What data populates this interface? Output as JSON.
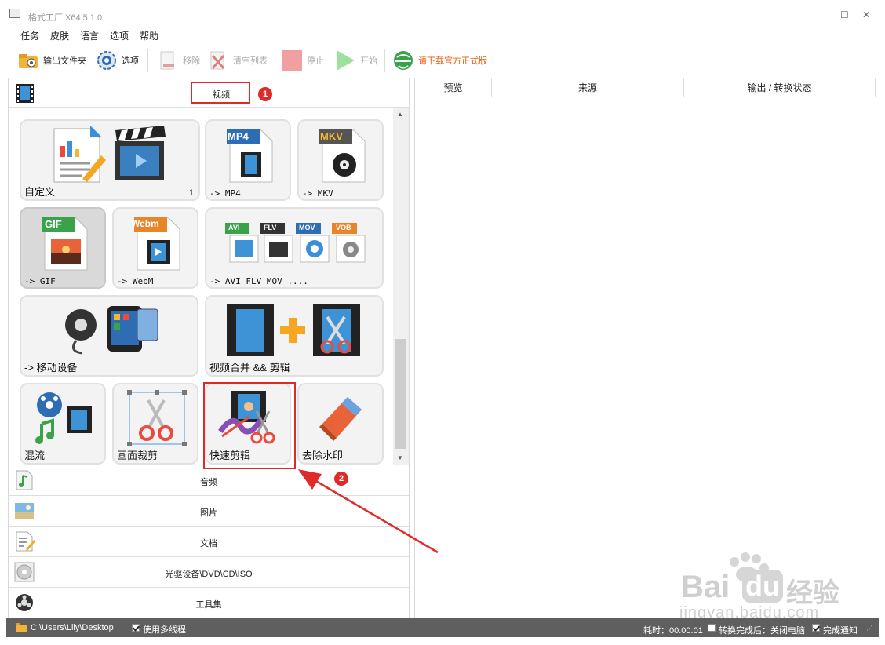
{
  "window": {
    "title": "格式工厂 X64 5.1.0",
    "minimize": "–",
    "maximize": "☐",
    "close": "✕"
  },
  "menu": [
    "任务",
    "皮肤",
    "语言",
    "选项",
    "帮助"
  ],
  "toolbar": {
    "output_folder": "输出文件夹",
    "options": "选项",
    "remove": "移除",
    "clear_list": "清空列表",
    "stop": "停止",
    "start": "开始",
    "download": "请下载官方正式版"
  },
  "video_section": {
    "title": "视频"
  },
  "tiles": [
    {
      "label": "自定义",
      "count": "1"
    },
    {
      "label": "-> MP4",
      "badge": "MP4"
    },
    {
      "label": "-> MKV",
      "badge": "MKV"
    },
    {
      "label": "-> GIF",
      "badge": "GIF"
    },
    {
      "label": "-> WebM",
      "badge": "Webm"
    },
    {
      "label": "-> AVI FLV MOV ....",
      "badges": [
        "AVI",
        "FLV",
        "MOV",
        "VOB"
      ]
    },
    {
      "label": "-> 移动设备"
    },
    {
      "label": "视频合并 && 剪辑"
    },
    {
      "label": "混流"
    },
    {
      "label": "画面裁剪"
    },
    {
      "label": "快速剪辑"
    },
    {
      "label": "去除水印"
    }
  ],
  "categories": [
    "音频",
    "图片",
    "文档",
    "光驱设备\\DVD\\CD\\ISO",
    "工具集"
  ],
  "task_table": {
    "columns": [
      "预览",
      "来源",
      "输出 / 转换状态"
    ]
  },
  "status_bar": {
    "path": "C:\\Users\\Lily\\Desktop",
    "multithread": "使用多线程",
    "elapsed": "耗时：00:00:01",
    "after_convert": "转换完成后：关闭电脑",
    "notify": "完成通知"
  },
  "annotations": {
    "step1": "1",
    "step2": "2"
  },
  "watermark": {
    "brand_a": "Bai",
    "brand_b": "du",
    "brand_c": "经验",
    "url": "jingyan.baidu.com"
  },
  "colors": {
    "annotation_red": "#e02a2a",
    "download_orange": "#e85c0d",
    "statusbar": "#5f5f5f"
  }
}
